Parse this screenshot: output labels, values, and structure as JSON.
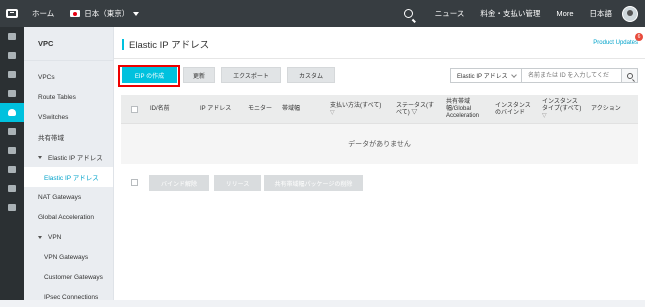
{
  "topbar": {
    "home": "ホーム",
    "region": "日本（東京）",
    "news": "ニュース",
    "billing": "料金・支払い管理",
    "more": "More",
    "language": "日本語"
  },
  "iconbar": [
    "list-icon",
    "cube-icon",
    "shield-icon",
    "cloud-icon",
    "database-icon",
    "tools-icon",
    "network-icon",
    "server-icon",
    "storage-icon",
    "circle-icon"
  ],
  "sidenav": {
    "title": "VPC",
    "items": [
      "VPCs",
      "Route Tables",
      "VSwitches",
      "共有帯域",
      "Elastic IP アドレス",
      "Elastic IP アドレス",
      "NAT Gateways",
      "Global Acceleration",
      "VPN",
      "VPN Gateways",
      "Customer Gateways",
      "IPsec Connections"
    ]
  },
  "main": {
    "title": "Elastic IP アドレス",
    "product_updates": "Product Updates",
    "badge_count": "6",
    "toolbar": {
      "create": "EIP の作成",
      "refresh": "更新",
      "export": "エクスポート",
      "custom": "カスタム"
    },
    "filter": {
      "selected": "Elastic IP アドレス",
      "placeholder": "名前または ID を入力してくだ"
    },
    "table": {
      "headers": {
        "id": "ID/名前",
        "ip": "IP アドレス",
        "monitor": "モニター",
        "bandwidth": "帯域幅",
        "billing_l1": "支払い方法(すべて)",
        "billing_l2": "▽",
        "status_l1": "ステータス(す",
        "status_l2": "べて) ▽",
        "shared_l1": "共有帯域",
        "shared_l2": "幅/Global",
        "shared_l3": "Acceleration",
        "instance_l1": "インスタンス",
        "instance_l2": "のバインド",
        "itype_l1": "インスタンス",
        "itype_l2": "タイプ(すべて)",
        "itype_l3": "▽",
        "actions": "アクション"
      },
      "empty": "データがありません"
    },
    "footer": {
      "unbind": "バインド解除",
      "release": "リリース",
      "remove_shared": "共有帯域幅パッケージの削除"
    }
  },
  "colors": {
    "topbar": "#373d41",
    "accent": "#00c1de",
    "highlight": "#e00000"
  }
}
